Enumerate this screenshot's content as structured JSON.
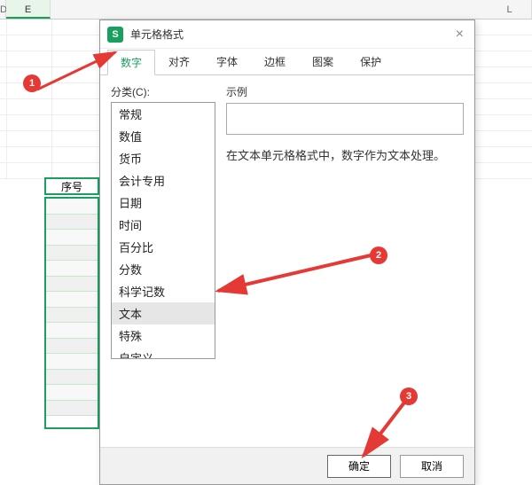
{
  "columns": {
    "d": "D",
    "e": "E",
    "l": "L"
  },
  "spreadsheet": {
    "header_cell": "序号"
  },
  "dialog": {
    "app_icon_letter": "S",
    "title": "单元格格式",
    "tabs": [
      "数字",
      "对齐",
      "字体",
      "边框",
      "图案",
      "保护"
    ],
    "active_tab": "数字",
    "category_label": "分类(C):",
    "categories": [
      "常规",
      "数值",
      "货币",
      "会计专用",
      "日期",
      "时间",
      "百分比",
      "分数",
      "科学记数",
      "文本",
      "特殊",
      "自定义"
    ],
    "selected_category": "文本",
    "example_label": "示例",
    "description": "在文本单元格格式中，数字作为文本处理。",
    "ok": "确定",
    "cancel": "取消"
  },
  "callouts": {
    "one": "1",
    "two": "2",
    "three": "3"
  }
}
